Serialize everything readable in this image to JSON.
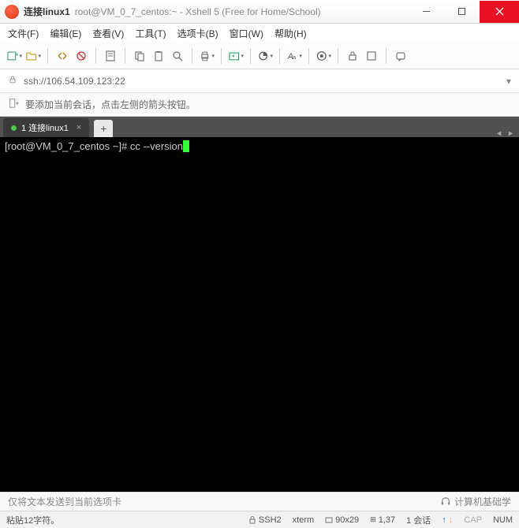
{
  "titlebar": {
    "main": "连接linux1",
    "sub": "root@VM_0_7_centos:~ - Xshell 5 (Free for Home/School)"
  },
  "menubar": [
    "文件(F)",
    "编辑(E)",
    "查看(V)",
    "工具(T)",
    "选项卡(B)",
    "窗口(W)",
    "帮助(H)"
  ],
  "addrbar": {
    "text": "ssh://106.54.109.123:22"
  },
  "hintbar": {
    "text": "要添加当前会话，点击左侧的箭头按钮。"
  },
  "tab": {
    "label": "1 连接linux1"
  },
  "terminal": {
    "prompt": "[root@VM_0_7_centos ~]# ",
    "command": "cc --version"
  },
  "bottom_hint": {
    "text": "仅将文本发送到当前选项卡",
    "brand": "计算机基础学"
  },
  "statusbar": {
    "left": "粘贴12字符。",
    "ssh": "SSH2",
    "termtype": "xterm",
    "size": "90x29",
    "pos": "1,37",
    "session": "1 会话",
    "caps": "CAP",
    "num": "NUM"
  }
}
